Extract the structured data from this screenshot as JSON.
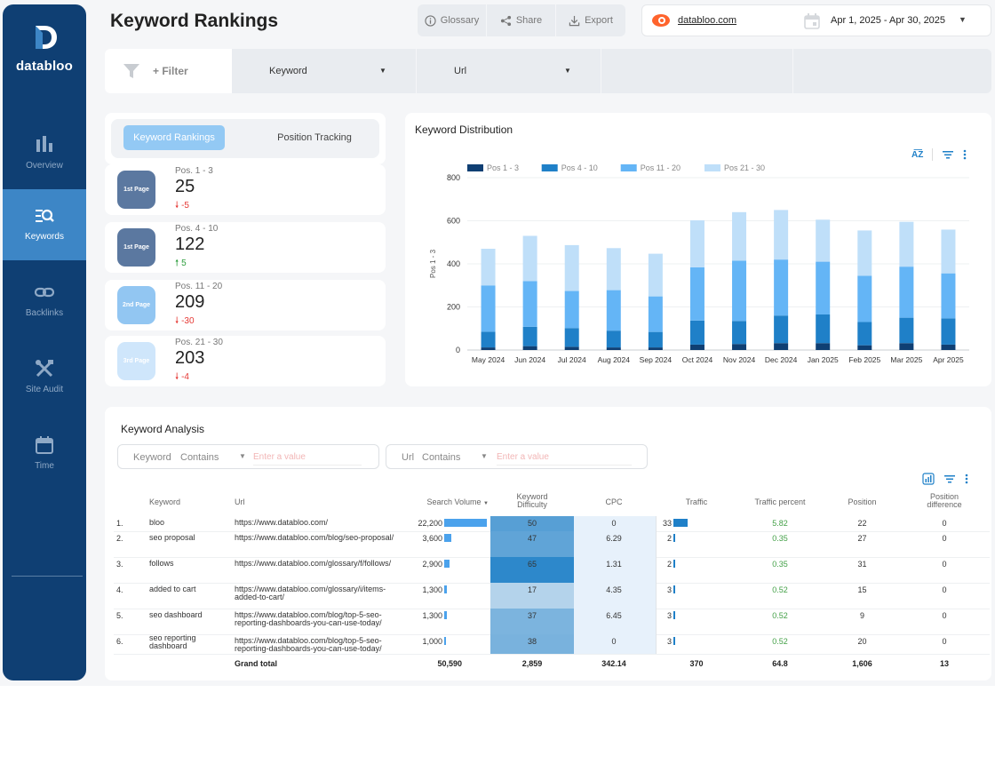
{
  "brand": {
    "name": "databloo"
  },
  "sidebar": {
    "items": [
      {
        "label": "Overview",
        "icon": "bar-chart-icon",
        "active": false
      },
      {
        "label": "Keywords",
        "icon": "keyword-search-icon",
        "active": true
      },
      {
        "label": "Backlinks",
        "icon": "link-icon",
        "active": false
      },
      {
        "label": "Site Audit",
        "icon": "tools-icon",
        "active": false
      },
      {
        "label": "Time",
        "icon": "calendar-icon",
        "active": false
      }
    ]
  },
  "header": {
    "title": "Keyword Rankings",
    "toolbar": {
      "glossary": "Glossary",
      "share": "Share",
      "export": "Export"
    },
    "site": "databloo.com",
    "date_range": "Apr 1, 2025 - Apr 30, 2025"
  },
  "filters": {
    "add_label": "+ Filter",
    "dropdowns": [
      "Keyword",
      "Url"
    ]
  },
  "ranking_card": {
    "tabs": [
      "Keyword Rankings",
      "Position Tracking"
    ],
    "rows": [
      {
        "badge": "1st Page",
        "badge_color": "#5b78a0",
        "label": "Pos. 1 - 3",
        "value": "25",
        "change": "-5",
        "direction": "down"
      },
      {
        "badge": "1st Page",
        "badge_color": "#5b78a0",
        "label": "Pos. 4 - 10",
        "value": "122",
        "change": "5",
        "direction": "up"
      },
      {
        "badge": "2nd Page",
        "badge_color": "#92c6f2",
        "label": "Pos. 11 - 20",
        "value": "209",
        "change": "-30",
        "direction": "down"
      },
      {
        "badge": "3rd Page",
        "badge_color": "#cfe6fb",
        "label": "Pos. 21 - 30",
        "value": "203",
        "change": "-4",
        "direction": "down"
      }
    ]
  },
  "chart_data": {
    "type": "bar",
    "stacked": true,
    "title": "Keyword Distribution",
    "ylabel": "Pos 1 - 3",
    "xlabel": "",
    "ylim": [
      0,
      800
    ],
    "yticks": [
      0,
      200,
      400,
      600,
      800
    ],
    "categories": [
      "May 2024",
      "Jun 2024",
      "Jul 2024",
      "Aug 2024",
      "Sep 2024",
      "Oct 2024",
      "Nov 2024",
      "Dec 2024",
      "Jan 2025",
      "Feb 2025",
      "Mar 2025",
      "Apr 2025"
    ],
    "series": [
      {
        "name": "Pos 1 - 3",
        "color": "#0f3f73",
        "values": [
          12,
          18,
          15,
          12,
          12,
          25,
          28,
          32,
          32,
          22,
          32,
          25
        ]
      },
      {
        "name": "Pos 4 - 10",
        "color": "#1f80c8",
        "values": [
          73,
          90,
          87,
          78,
          72,
          112,
          107,
          128,
          133,
          108,
          118,
          122
        ]
      },
      {
        "name": "Pos 11 - 20",
        "color": "#64b5f6",
        "values": [
          215,
          212,
          172,
          188,
          165,
          247,
          280,
          260,
          245,
          215,
          237,
          209
        ]
      },
      {
        "name": "Pos 21 - 30",
        "color": "#bfdff9",
        "values": [
          170,
          210,
          213,
          195,
          198,
          218,
          225,
          230,
          195,
          210,
          208,
          203
        ]
      }
    ],
    "legend": "top-left",
    "grid": true
  },
  "analysis": {
    "title": "Keyword Analysis",
    "filter_keyword": {
      "label": "Keyword",
      "op": "Contains",
      "placeholder": "Enter a value"
    },
    "filter_url": {
      "label": "Url",
      "op": "Contains",
      "placeholder": "Enter a value"
    },
    "columns": [
      "Keyword",
      "Url",
      "Search Volume",
      "Keyword Difficulty",
      "CPC",
      "Traffic",
      "Traffic percent",
      "Position",
      "Position difference"
    ],
    "rows": [
      {
        "n": "1.",
        "keyword": "bloo",
        "url": "https://www.databloo.com/",
        "volume": "22,200",
        "volume_num": 22200,
        "kd": "50",
        "kd_num": 50,
        "cpc": "0",
        "traffic": "33",
        "traffic_num": 33,
        "tp": "5.82",
        "pos": "22",
        "diff": "0"
      },
      {
        "n": "2.",
        "keyword": "seo proposal",
        "url": "https://www.databloo.com/blog/seo-proposal/",
        "volume": "3,600",
        "volume_num": 3600,
        "kd": "47",
        "kd_num": 47,
        "cpc": "6.29",
        "traffic": "2",
        "traffic_num": 2,
        "tp": "0.35",
        "pos": "27",
        "diff": "0"
      },
      {
        "n": "3.",
        "keyword": "follows",
        "url": "https://www.databloo.com/glossary/f/follows/",
        "volume": "2,900",
        "volume_num": 2900,
        "kd": "65",
        "kd_num": 65,
        "cpc": "1.31",
        "traffic": "2",
        "traffic_num": 2,
        "tp": "0.35",
        "pos": "31",
        "diff": "0"
      },
      {
        "n": "4.",
        "keyword": "added to cart",
        "url": "https://www.databloo.com/glossary/i/items-added-to-cart/",
        "volume": "1,300",
        "volume_num": 1300,
        "kd": "17",
        "kd_num": 17,
        "cpc": "4.35",
        "traffic": "3",
        "traffic_num": 3,
        "tp": "0.52",
        "pos": "15",
        "diff": "0"
      },
      {
        "n": "5.",
        "keyword": "seo dashboard",
        "url": "https://www.databloo.com/blog/top-5-seo-reporting-dashboards-you-can-use-today/",
        "volume": "1,300",
        "volume_num": 1300,
        "kd": "37",
        "kd_num": 37,
        "cpc": "6.45",
        "traffic": "3",
        "traffic_num": 3,
        "tp": "0.52",
        "pos": "9",
        "diff": "0"
      },
      {
        "n": "6.",
        "keyword": "seo reporting dashboard",
        "url": "https://www.databloo.com/blog/top-5-seo-reporting-dashboards-you-can-use-today/",
        "volume": "1,000",
        "volume_num": 1000,
        "kd": "38",
        "kd_num": 38,
        "cpc": "0",
        "traffic": "3",
        "traffic_num": 3,
        "tp": "0.52",
        "pos": "20",
        "diff": "0"
      }
    ],
    "total": {
      "label": "Grand total",
      "volume": "50,590",
      "kd": "2,859",
      "cpc": "342.14",
      "traffic": "370",
      "tp": "64.8",
      "pos": "1,606",
      "diff": "13"
    }
  }
}
